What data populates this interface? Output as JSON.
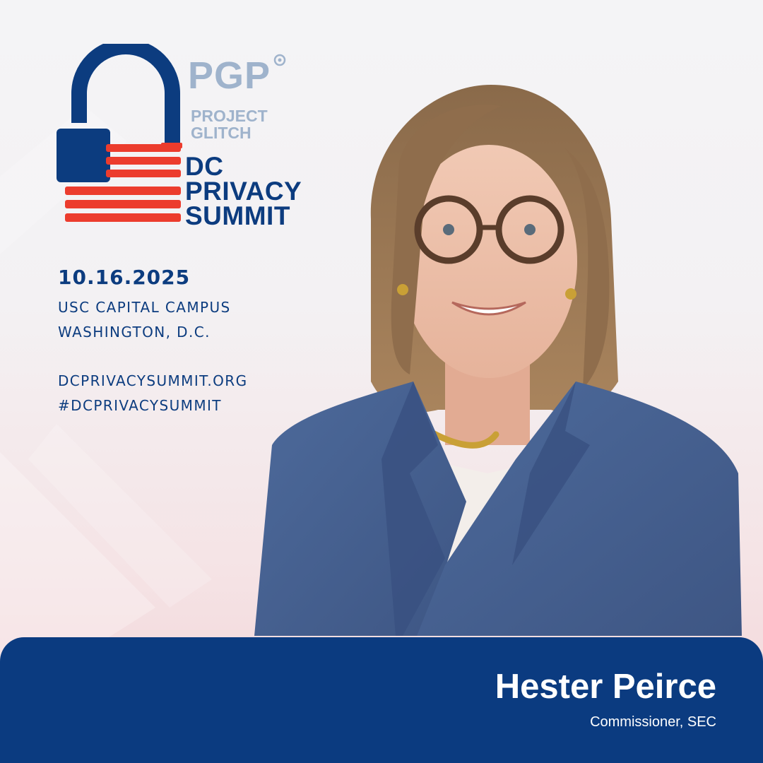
{
  "colors": {
    "navy": "#0c3c7f",
    "red": "#ec3c2d",
    "steel": "#9fb3cc",
    "banner": "#0b3b80"
  },
  "logo": {
    "pgp": "PGP",
    "project_line1": "PROJECT",
    "project_line2": "GLITCH",
    "title_line1": "DC",
    "title_line2": "PRIVACY",
    "title_line3": "SUMMIT"
  },
  "event": {
    "date": "10.16.2025",
    "venue": "USC CAPITAL CAMPUS",
    "city": "WASHINGTON, D.C.",
    "website": "DCPRIVACYSUMMIT.ORG",
    "hashtag": "#DCPRIVACYSUMMIT"
  },
  "speaker": {
    "name": "Hester Peirce",
    "title": "Commissioner, SEC"
  }
}
